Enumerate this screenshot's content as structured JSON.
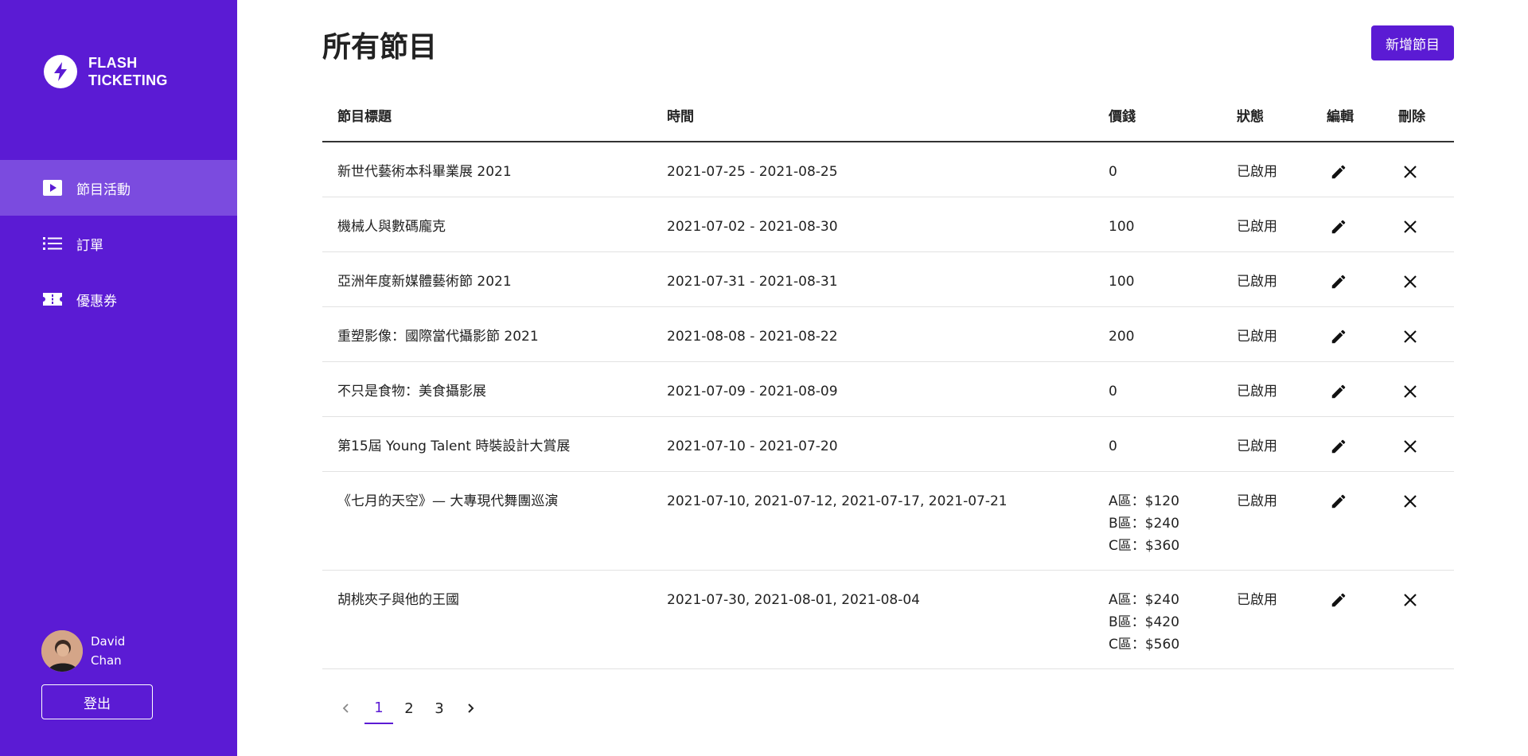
{
  "brand": {
    "line1": "FLASH",
    "line2": "TICKETING"
  },
  "nav": [
    {
      "label": "節目活動",
      "icon": "play-icon",
      "active": true
    },
    {
      "label": "訂單",
      "icon": "list-icon",
      "active": false
    },
    {
      "label": "優惠券",
      "icon": "ticket-icon",
      "active": false
    }
  ],
  "user": {
    "first": "David",
    "last": "Chan",
    "logout": "登出"
  },
  "page": {
    "title": "所有節目",
    "add_button": "新增節目"
  },
  "table": {
    "headers": {
      "title": "節目標題",
      "time": "時間",
      "price": "價錢",
      "status": "狀態",
      "edit": "編輯",
      "delete": "刪除"
    },
    "rows": [
      {
        "title": "新世代藝術本科畢業展 2021",
        "time": "2021-07-25 - 2021-08-25",
        "price": [
          "0"
        ],
        "status": "已啟用"
      },
      {
        "title": "機械人與數碼龐克",
        "time": "2021-07-02 - 2021-08-30",
        "price": [
          "100"
        ],
        "status": "已啟用"
      },
      {
        "title": "亞洲年度新媒體藝術節 2021",
        "time": "2021-07-31 - 2021-08-31",
        "price": [
          "100"
        ],
        "status": "已啟用"
      },
      {
        "title": "重塑影像：國際當代攝影節 2021",
        "time": "2021-08-08 - 2021-08-22",
        "price": [
          "200"
        ],
        "status": "已啟用"
      },
      {
        "title": "不只是食物：美食攝影展",
        "time": "2021-07-09 - 2021-08-09",
        "price": [
          "0"
        ],
        "status": "已啟用"
      },
      {
        "title": "第15屆 Young Talent 時裝設計大賞展",
        "time": "2021-07-10 - 2021-07-20",
        "price": [
          "0"
        ],
        "status": "已啟用"
      },
      {
        "title": "《七月的天空》— 大專現代舞團巡演",
        "time": "2021-07-10, 2021-07-12, 2021-07-17, 2021-07-21",
        "price": [
          "A區：$120",
          "B區：$240",
          "C區：$360"
        ],
        "status": "已啟用"
      },
      {
        "title": "胡桃夾子與他的王國",
        "time": "2021-07-30, 2021-08-01, 2021-08-04",
        "price": [
          "A區：$240",
          "B區：$420",
          "C區：$560"
        ],
        "status": "已啟用"
      }
    ]
  },
  "pagination": {
    "pages": [
      "1",
      "2",
      "3"
    ],
    "current": "1"
  },
  "colors": {
    "brand": "#5b1bd4",
    "nav_active": "#7b4bdf"
  }
}
